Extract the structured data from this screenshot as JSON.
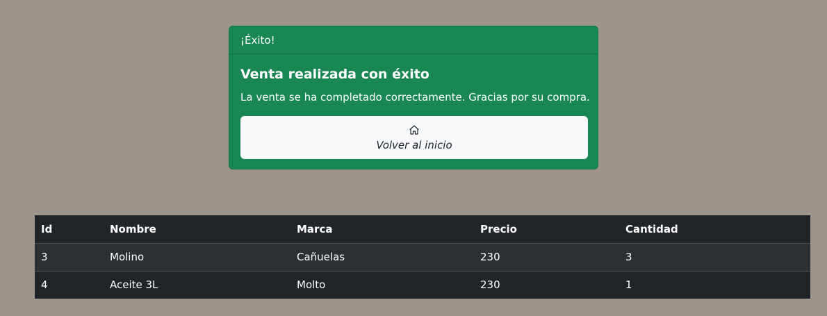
{
  "alert_card": {
    "header": "¡Éxito!",
    "title": "Venta realizada con éxito",
    "message": "La venta se ha completado correctamente. Gracias por su compra.",
    "button_label": "Volver al inicio",
    "button_icon": "home-icon",
    "color": "#198754"
  },
  "sales_table": {
    "columns": [
      "Id",
      "Nombre",
      "Marca",
      "Precio",
      "Cantidad"
    ],
    "rows": [
      [
        "3",
        "Molino",
        "Cañuelas",
        "230",
        "3"
      ],
      [
        "4",
        "Aceite 3L",
        "Molto",
        "230",
        "1"
      ]
    ]
  }
}
